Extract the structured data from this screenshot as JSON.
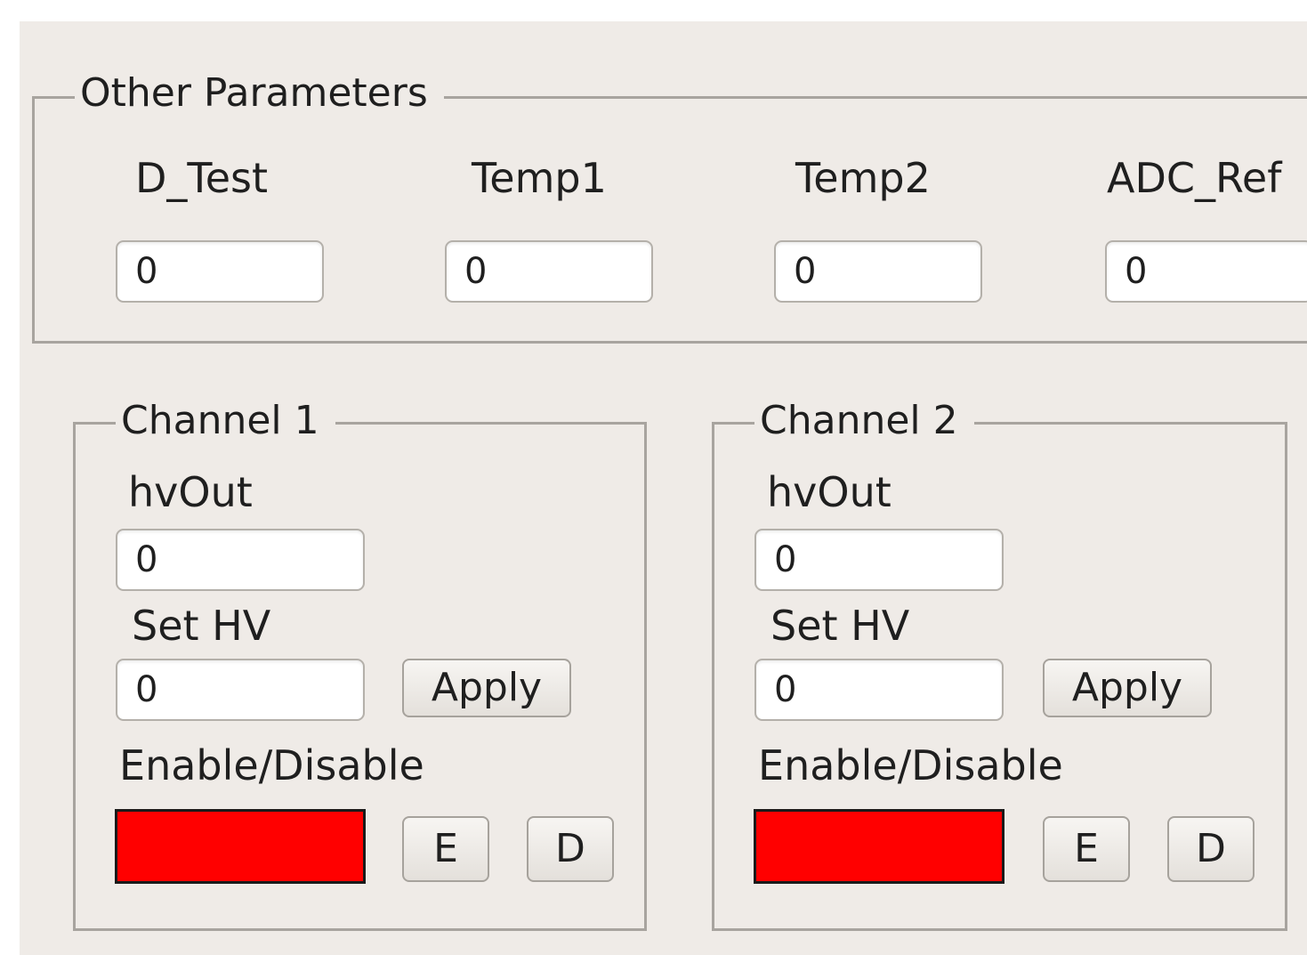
{
  "other_parameters": {
    "title": "Other Parameters",
    "fields": [
      {
        "label": "D_Test",
        "value": "0"
      },
      {
        "label": "Temp1",
        "value": "0"
      },
      {
        "label": "Temp2",
        "value": "0"
      },
      {
        "label": "ADC_Ref",
        "value": "0"
      }
    ]
  },
  "channels": [
    {
      "title": "Channel 1",
      "hvout_label": "hvOut",
      "hvout_value": "0",
      "sethv_label": "Set HV",
      "sethv_value": "0",
      "apply_label": "Apply",
      "enable_disable_label": "Enable/Disable",
      "status_color": "#ff0000",
      "enable_label": "E",
      "disable_label": "D"
    },
    {
      "title": "Channel 2",
      "hvout_label": "hvOut",
      "hvout_value": "0",
      "sethv_label": "Set HV",
      "sethv_value": "0",
      "apply_label": "Apply",
      "enable_disable_label": "Enable/Disable",
      "status_color": "#ff0000",
      "enable_label": "E",
      "disable_label": "D"
    }
  ]
}
